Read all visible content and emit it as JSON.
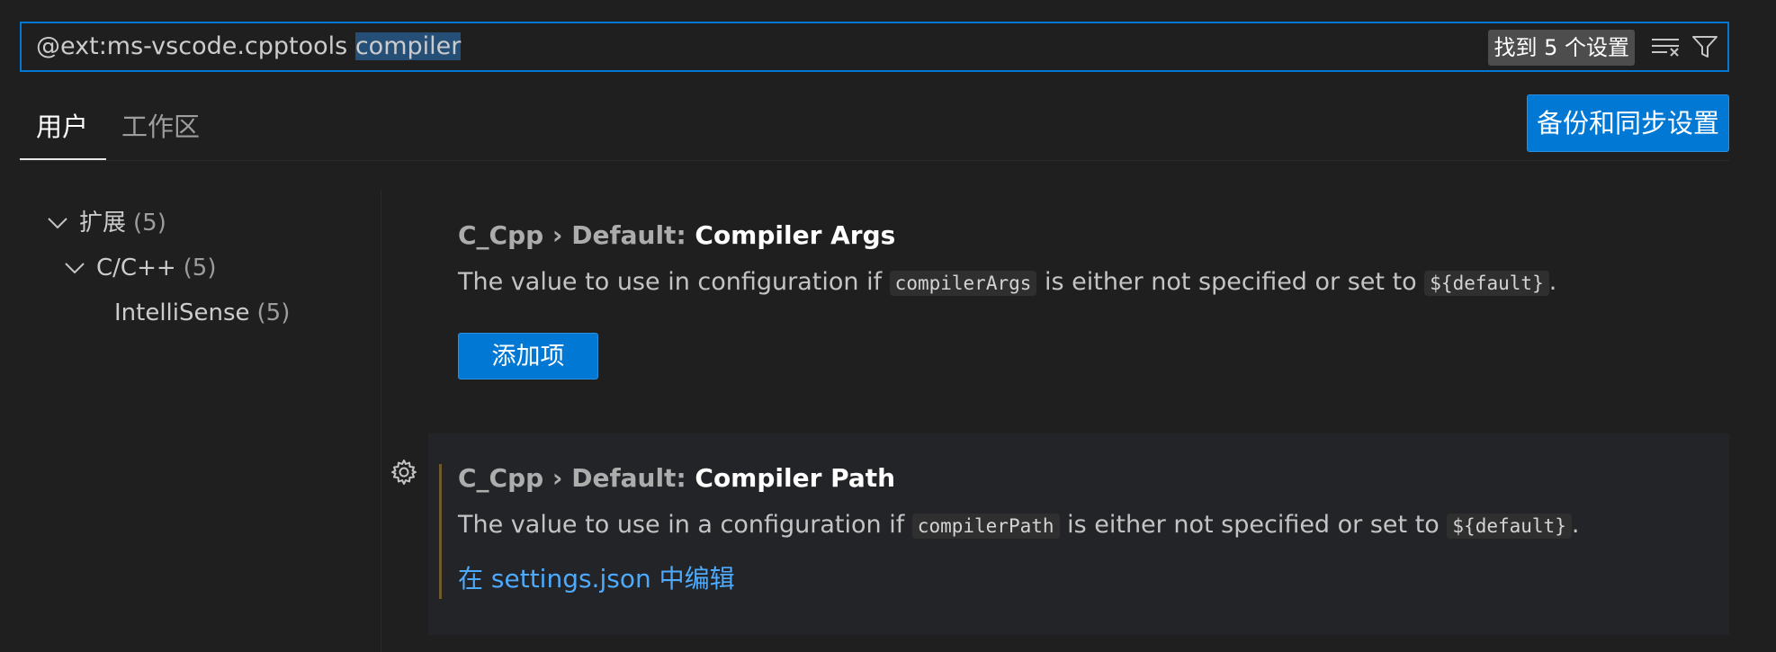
{
  "search": {
    "query_prefix": "@ext:ms-vscode.cpptools ",
    "query_highlight": "compiler",
    "result_count": "找到 5 个设置",
    "clear_icon": "clear-filter-icon",
    "filter_icon": "filter-icon"
  },
  "tabs": [
    {
      "label": "用户",
      "active": true
    },
    {
      "label": "工作区",
      "active": false
    }
  ],
  "sync_button": "备份和同步设置",
  "toc": {
    "items": [
      {
        "label": "扩展",
        "count": "(5)",
        "expanded": true,
        "level": 0
      },
      {
        "label": "C/C++",
        "count": "(5)",
        "expanded": true,
        "level": 1
      },
      {
        "label": "IntelliSense",
        "count": "(5)",
        "expanded": false,
        "level": 2
      }
    ]
  },
  "settings": [
    {
      "category": "C_Cpp › Default: ",
      "name": "Compiler Args",
      "desc_before": "The value to use in configuration if ",
      "desc_code1": "compilerArgs",
      "desc_middle": " is either not specified or set to ",
      "desc_code2": "${default}",
      "desc_after": ".",
      "action_label": "添加项"
    },
    {
      "category": "C_Cpp › Default: ",
      "name": "Compiler Path",
      "desc_before": "The value to use in a configuration if ",
      "desc_code1": "compilerPath",
      "desc_middle": " is either not specified or set to ",
      "desc_code2": "${default}",
      "desc_after": ".",
      "action_label": "在 settings.json 中编辑",
      "modified_color": "#6e5a2b",
      "gear_icon": "gear-icon"
    }
  ],
  "colors": {
    "accent": "#0078d4",
    "link": "#4daafc",
    "background": "#1f1f1f",
    "focused_row": "#232427"
  }
}
